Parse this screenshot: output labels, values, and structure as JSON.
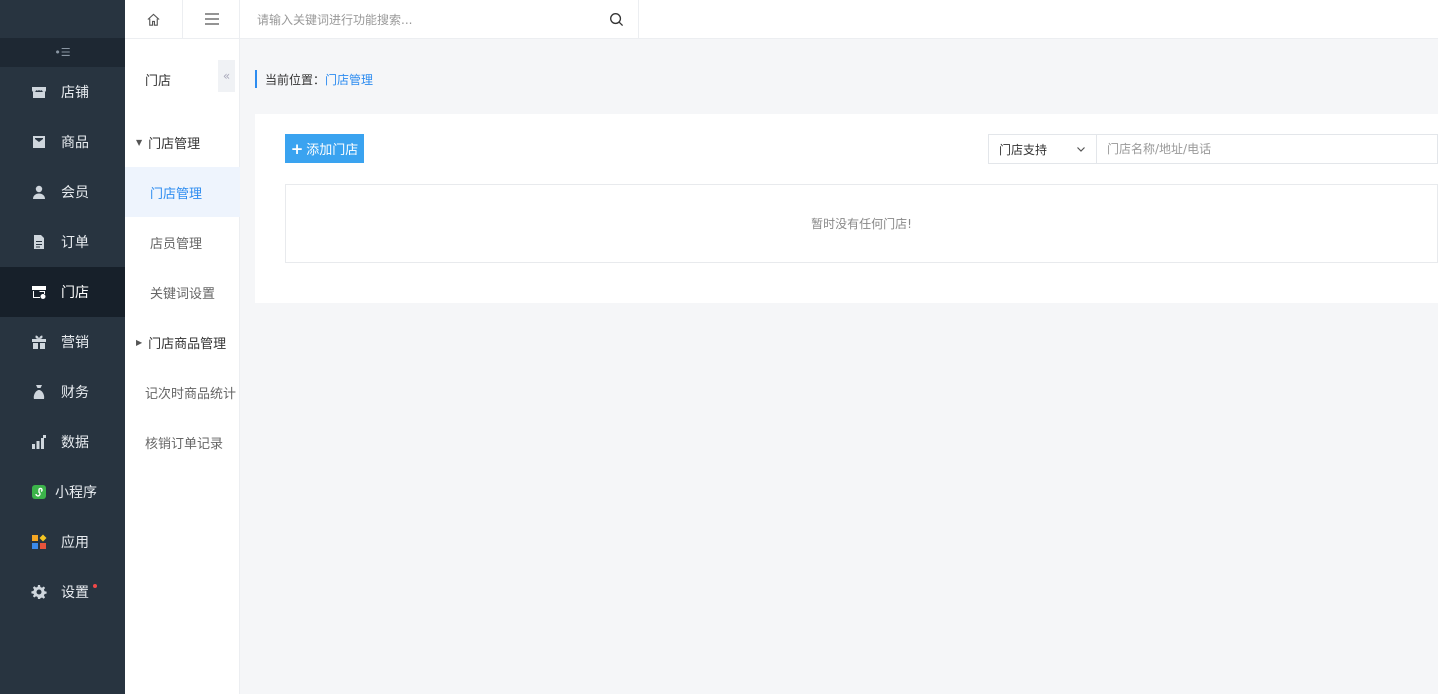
{
  "sidebar": {
    "items": [
      {
        "label": "店铺",
        "icon": "store-icon"
      },
      {
        "label": "商品",
        "icon": "goods-icon"
      },
      {
        "label": "会员",
        "icon": "user-icon"
      },
      {
        "label": "订单",
        "icon": "order-icon"
      },
      {
        "label": "门店",
        "icon": "shop-icon",
        "active": true
      },
      {
        "label": "营销",
        "icon": "gift-icon"
      },
      {
        "label": "财务",
        "icon": "money-bag-icon"
      },
      {
        "label": "数据",
        "icon": "bar-chart-icon"
      },
      {
        "label": "小程序",
        "icon": "mini-program-icon"
      },
      {
        "label": "应用",
        "icon": "apps-icon"
      },
      {
        "label": "设置",
        "icon": "gear-icon",
        "badge": "red-dot"
      }
    ]
  },
  "subnav": {
    "title": "门店",
    "items": [
      {
        "label": "门店管理",
        "type": "group",
        "expanded": true
      },
      {
        "label": "门店管理",
        "type": "child",
        "active": true
      },
      {
        "label": "店员管理",
        "type": "child"
      },
      {
        "label": "关键词设置",
        "type": "child"
      },
      {
        "label": "门店商品管理",
        "type": "group",
        "expanded": false
      },
      {
        "label": "记次时商品统计",
        "type": "plain"
      },
      {
        "label": "核销订单记录",
        "type": "plain"
      }
    ]
  },
  "topbar": {
    "search_placeholder": "请输入关键词进行功能搜索..."
  },
  "breadcrumb": {
    "prefix": "当前位置：",
    "current": "门店管理"
  },
  "content": {
    "add_button": "添加门店",
    "select_value": "门店支持",
    "filter_placeholder": "门店名称/地址/电话",
    "empty_text": "暂时没有任何门店!"
  },
  "colors": {
    "sidebar_bg": "#283440",
    "accent": "#2d8cf0",
    "button": "#3aa3f0"
  }
}
